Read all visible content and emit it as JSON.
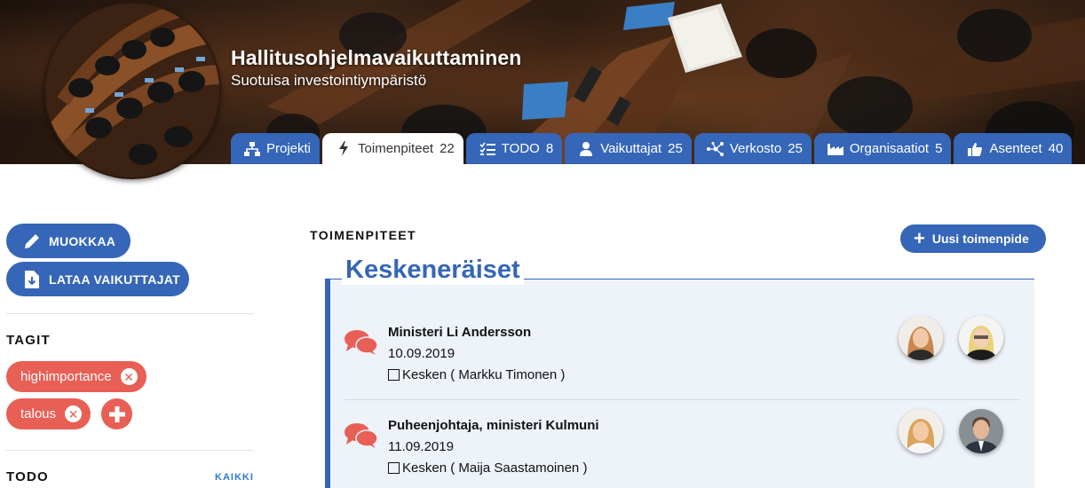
{
  "header": {
    "title": "Hallitusohjelmavaikuttaminen",
    "subtitle": "Suotuisa investointiympäristö"
  },
  "tabs": [
    {
      "label": "Projekti",
      "count": "",
      "icon": "sitemap-icon",
      "active": false
    },
    {
      "label": "Toimenpiteet",
      "count": "22",
      "icon": "bolt-icon",
      "active": true
    },
    {
      "label": "TODO",
      "count": "8",
      "icon": "checklist-icon",
      "active": false
    },
    {
      "label": "Vaikuttajat",
      "count": "25",
      "icon": "user-icon",
      "active": false
    },
    {
      "label": "Verkosto",
      "count": "25",
      "icon": "network-icon",
      "active": false
    },
    {
      "label": "Organisaatiot",
      "count": "5",
      "icon": "factory-icon",
      "active": false
    },
    {
      "label": "Asenteet",
      "count": "40",
      "icon": "thumbs-up-icon",
      "active": false
    }
  ],
  "sidebar": {
    "edit_label": "MUOKKAA",
    "load_label": "LATAA VAIKUTTAJAT",
    "tags_heading": "TAGIT",
    "tags": [
      "highimportance",
      "talous"
    ],
    "todo_heading": "TODO",
    "all_link": "KAIKKI"
  },
  "main": {
    "section_title": "TOIMENPITEET",
    "new_button": "Uusi toimenpide",
    "group_title": "Keskeneräiset",
    "items": [
      {
        "title": "Ministeri Li Andersson",
        "date": "10.09.2019",
        "status": "Kesken ( Markku Timonen )"
      },
      {
        "title": "Puheenjohtaja, ministeri Kulmuni",
        "date": "11.09.2019",
        "status": "Kesken ( Maija Saastamoinen )"
      }
    ]
  },
  "colors": {
    "primary": "#3566b8",
    "tag": "#e85f55",
    "link": "#2f7ad6",
    "panel_bg": "#eef2f9"
  }
}
